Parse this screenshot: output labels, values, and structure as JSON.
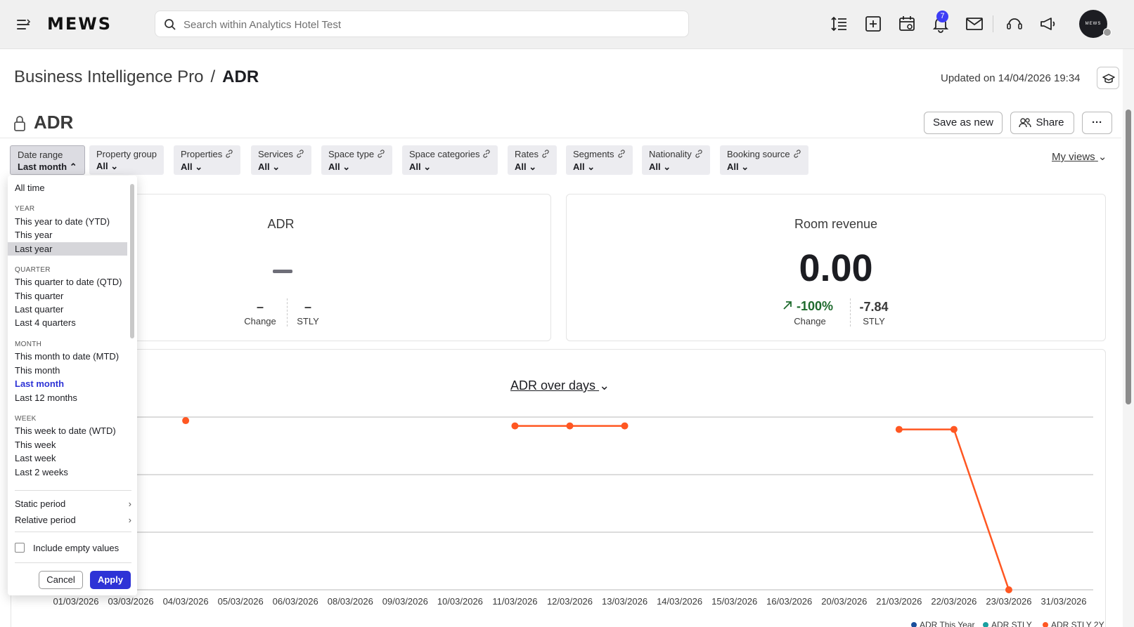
{
  "app": {
    "logo": "MEWS"
  },
  "search": {
    "placeholder": "Search within Analytics Hotel Test"
  },
  "notifications": {
    "count": "7"
  },
  "avatar": {
    "initials": "MEWS"
  },
  "breadcrumb": {
    "parent": "Business Intelligence Pro",
    "separator": "/",
    "current": "ADR"
  },
  "header": {
    "updated": "Updated on 14/04/2026 19:34"
  },
  "report": {
    "title": "ADR",
    "buttons": {
      "save_as_new": "Save as new",
      "share": "Share",
      "more": "···"
    }
  },
  "filters": [
    {
      "label": "Date range",
      "value": "Last month"
    },
    {
      "label": "Property group",
      "value": "All"
    },
    {
      "label": "Properties",
      "value": "All"
    },
    {
      "label": "Services",
      "value": "All"
    },
    {
      "label": "Space type",
      "value": "All"
    },
    {
      "label": "Space categories",
      "value": "All"
    },
    {
      "label": "Rates",
      "value": "All"
    },
    {
      "label": "Segments",
      "value": "All"
    },
    {
      "label": "Nationality",
      "value": "All"
    },
    {
      "label": "Booking source",
      "value": "All"
    }
  ],
  "my_views": "My views",
  "kpi": {
    "adr": {
      "title": "ADR",
      "change": "–",
      "change_label": "Change",
      "stly": "–",
      "stly_label": "STLY"
    },
    "room_revenue": {
      "title": "Room revenue",
      "value": "0.00",
      "change": "-100%",
      "change_label": "Change",
      "stly": "-7.84",
      "stly_label": "STLY"
    }
  },
  "chart": {
    "selector": "ADR over days"
  },
  "chart_data": {
    "type": "line",
    "categories": [
      "01/03/2026",
      "03/03/2026",
      "04/03/2026",
      "05/03/2026",
      "06/03/2026",
      "08/03/2026",
      "09/03/2026",
      "10/03/2026",
      "11/03/2026",
      "12/03/2026",
      "13/03/2026",
      "14/03/2026",
      "15/03/2026",
      "16/03/2026",
      "20/03/2026",
      "21/03/2026",
      "22/03/2026",
      "23/03/2026",
      "31/03/2026"
    ],
    "series": [
      {
        "name": "ADR STLY 2Y",
        "color": "#ff5722",
        "values": [
          null,
          null,
          96,
          null,
          null,
          null,
          null,
          null,
          93,
          93,
          93,
          null,
          null,
          null,
          null,
          91,
          91,
          0,
          null
        ]
      }
    ],
    "legend": [
      "ADR This Year",
      "ADR STLY",
      "ADR STLY 2Y"
    ],
    "legend_colors": [
      "#1a4f9c",
      "#1aa0a0",
      "#ff5722"
    ],
    "legend_position": "bottom-right",
    "ylim": [
      0,
      100
    ],
    "grid": true
  },
  "date_menu": {
    "all_time": "All time",
    "groups": [
      {
        "heading": "YEAR",
        "items": [
          "This year to date (YTD)",
          "This year",
          "Last year"
        ]
      },
      {
        "heading": "QUARTER",
        "items": [
          "This quarter to date (QTD)",
          "This quarter",
          "Last quarter",
          "Last 4 quarters"
        ]
      },
      {
        "heading": "MONTH",
        "items": [
          "This month to date (MTD)",
          "This month",
          "Last month",
          "Last 12 months"
        ]
      },
      {
        "heading": "WEEK",
        "items": [
          "This week to date (WTD)",
          "This week",
          "Last week",
          "Last 2 weeks"
        ]
      }
    ],
    "static_period": "Static period",
    "relative_period": "Relative period",
    "include_empty": "Include empty values",
    "cancel": "Cancel",
    "apply": "Apply"
  },
  "colors": {
    "accent": "#2e33d6",
    "series": "#ff5722",
    "positive": "#1f6b2e"
  }
}
